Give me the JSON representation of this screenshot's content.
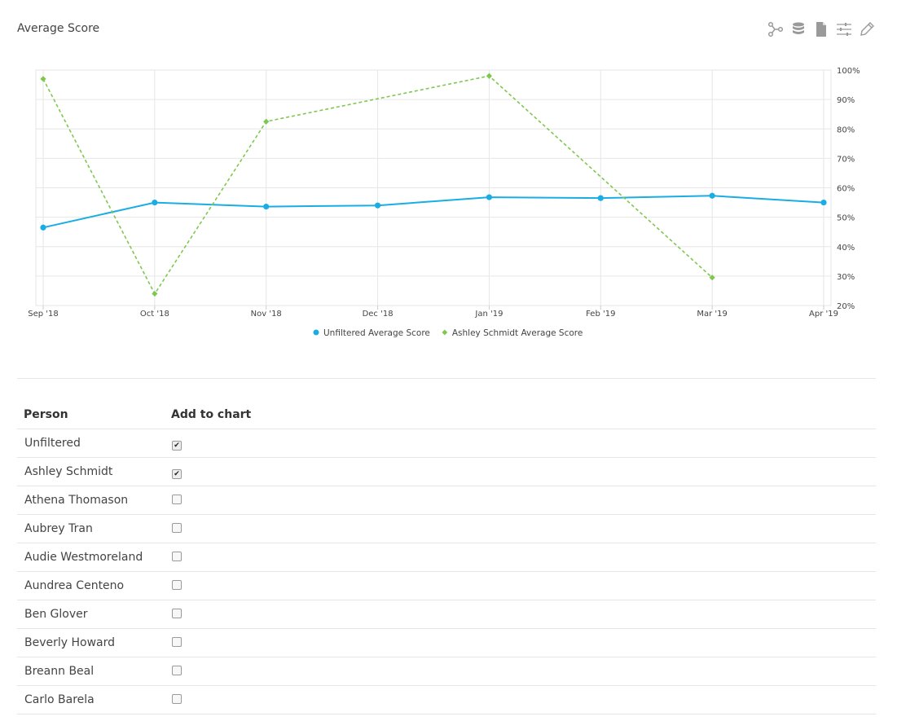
{
  "header": {
    "title": "Average Score",
    "tools": [
      {
        "icon": "share-nodes-icon"
      },
      {
        "icon": "database-icon"
      },
      {
        "icon": "file-icon"
      },
      {
        "icon": "sliders-icon"
      },
      {
        "icon": "pencil-icon"
      }
    ]
  },
  "chart_data": {
    "type": "line",
    "categories": [
      "Sep '18",
      "Oct '18",
      "Nov '18",
      "Dec '18",
      "Jan '19",
      "Feb '19",
      "Mar '19",
      "Apr '19"
    ],
    "y_ticks": [
      "100%",
      "90%",
      "80%",
      "70%",
      "60%",
      "50%",
      "40%",
      "30%",
      "20%"
    ],
    "ylim": [
      20,
      100
    ],
    "y_axis_side": "right",
    "grid": true,
    "legend_position": "bottom-center",
    "series": [
      {
        "name": "Unfiltered Average Score",
        "color": "#1aade4",
        "style": "solid",
        "marker": "circle",
        "values": [
          46.5,
          55,
          53.6,
          54,
          56.8,
          56.5,
          57.3,
          55
        ]
      },
      {
        "name": "Ashley Schmidt Average Score",
        "color": "#7ec850",
        "style": "dashed",
        "marker": "diamond",
        "values": [
          97,
          24,
          82.5,
          null,
          98,
          null,
          29.5,
          null
        ]
      }
    ]
  },
  "table": {
    "headers": {
      "person": "Person",
      "add": "Add to chart"
    },
    "rows": [
      {
        "name": "Unfiltered",
        "checked": true
      },
      {
        "name": "Ashley Schmidt",
        "checked": true
      },
      {
        "name": "Athena Thomason",
        "checked": false
      },
      {
        "name": "Aubrey Tran",
        "checked": false
      },
      {
        "name": "Audie Westmoreland",
        "checked": false
      },
      {
        "name": "Aundrea Centeno",
        "checked": false
      },
      {
        "name": "Ben Glover",
        "checked": false
      },
      {
        "name": "Beverly Howard",
        "checked": false
      },
      {
        "name": "Breann Beal",
        "checked": false
      },
      {
        "name": "Carlo Barela",
        "checked": false
      }
    ]
  }
}
